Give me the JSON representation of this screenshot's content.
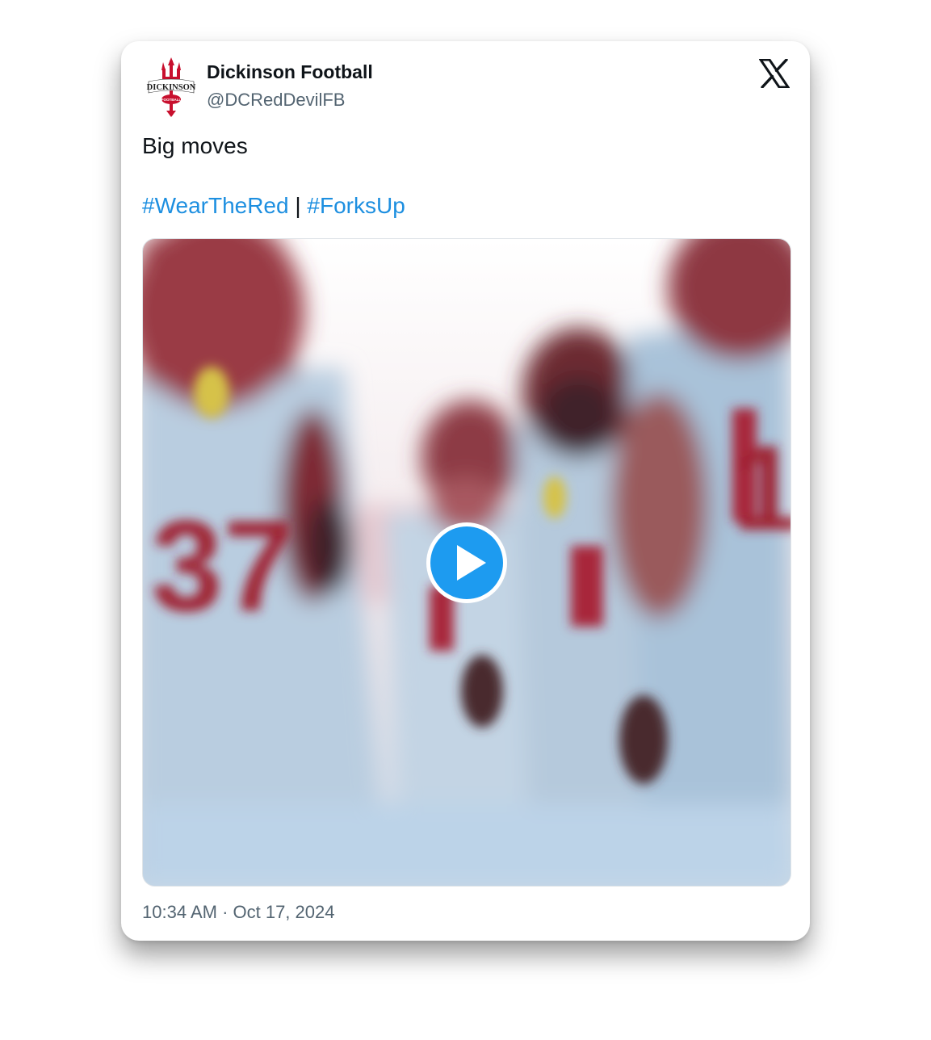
{
  "tweet": {
    "author": {
      "name": "Dickinson Football",
      "handle": "@DCRedDevilFB",
      "avatar_text": "DICKINSON",
      "avatar_subtext": "FOOTBALL"
    },
    "text": "Big moves",
    "hashtags": [
      "#WearTheRed",
      "#ForksUp"
    ],
    "separator": "|",
    "timestamp": "10:34 AM · Oct 17, 2024",
    "media": {
      "type": "video",
      "jersey_numbers": [
        "37",
        "1"
      ]
    }
  },
  "icons": {
    "platform": "x-logo-icon",
    "play": "play-icon"
  },
  "colors": {
    "hashtag": "#1d8fe0",
    "play_button": "#1d9bf0",
    "brand_red": "#c8102e",
    "text_primary": "#0f1419",
    "text_secondary": "#536471"
  }
}
